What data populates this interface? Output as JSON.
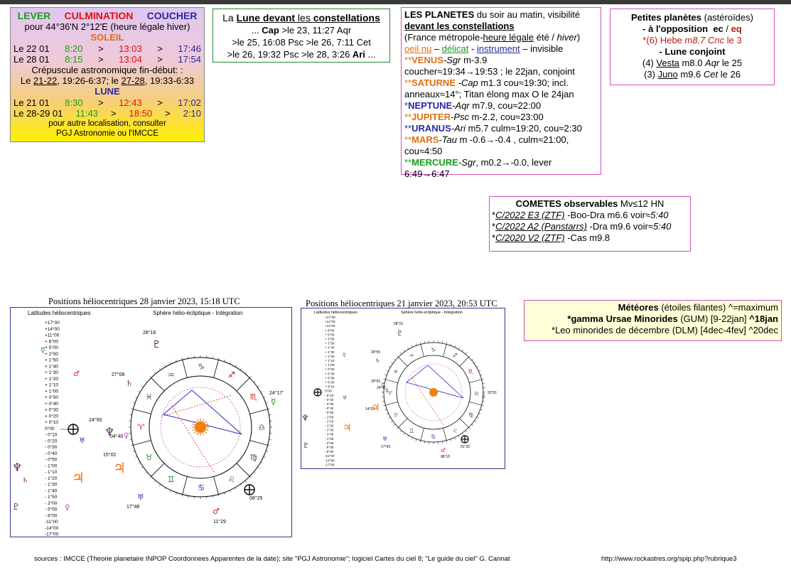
{
  "box1": {
    "hdr_lever": "LEVER",
    "hdr_culmination": "CULMINATION",
    "hdr_coucher": "COUCHER",
    "location": "pour 44°36'N  2°12'E (heure légale hiver)",
    "soleil_title": "SOLEIL",
    "soleil_rows": [
      {
        "date": "Le 22 01",
        "lever": "8:20",
        "culm": "13:03",
        "couch": "17:46"
      },
      {
        "date": "Le 28 01",
        "lever": "8:15",
        "culm": "13:04",
        "couch": "17:54"
      }
    ],
    "crepuscule_title": "Crépuscule astronomique fin-début: :",
    "crepuscule_pre": "Le ",
    "crepuscule_d1": "21-22",
    "crepuscule_mid": ", 19:26-6:37; le ",
    "crepuscule_d2": "27-28",
    "crepuscule_post": ", 19:33-6:33",
    "lune_title": "LUNE",
    "lune_rows": [
      {
        "date": "Le 21 01",
        "lever": "8:30",
        "culm": "12:43",
        "couch": "17:02"
      },
      {
        "date": "Le 28-29 01",
        "lever": "11:43",
        "culm": "18:50",
        "couch": "2:10"
      }
    ],
    "gt": ">",
    "footer1": "pour autre localisation, consulter",
    "footer2": "PGJ Astronomie ou l'IMCCE"
  },
  "box2": {
    "title_pre": "La ",
    "title_lune": "Lune devant",
    "title_mid": " les ",
    "title_const": "constellations",
    "l1_pre": "... ",
    "l1_b": "Cap",
    "l1_post": " >le 23, 11:27 Aqr",
    "l2": ">le 25, 16:08 Psc >le 26, 7:11 Cet",
    "l3_pre": ">le 26, 19:32 Psc >le 28, 3:26 ",
    "l3_b": "Ari",
    "l3_post": " ..."
  },
  "box3": {
    "title": "LES PLANETES",
    "title_post": " du soir au matin, visibilité",
    "subtitle": "devant les constellations",
    "france_pre": "(France métropole-",
    "france_u": "heure légale",
    "france_mid": " été / ",
    "france_i": "hiver",
    "france_post": ")",
    "leg_oeil": "oeil nu",
    "leg_sep1": " – ",
    "leg_delicat": "délicat",
    "leg_sep2": " - ",
    "leg_instrument": "instrument",
    "leg_sep3": " – invisible",
    "venus_star": "**",
    "venus": "VENUS",
    "venus_i": "-Sgr",
    "venus_m": " m-3.9",
    "venus_l2": "coucher≈19:34→19:53 ; le 22jan, conjoint",
    "saturne_star": "**",
    "saturne": "SATURNE",
    "saturne_i": " -Cap",
    "saturne_m": " m1.3 cou≈19:30; incl.",
    "saturne_l2": "anneaux≈14°; Titan élong max O le 24jan",
    "neptune_star": "*",
    "neptune": "NEPTUNE",
    "neptune_i": "-Aqr",
    "neptune_m": " m7.9, cou≈22:00",
    "jupiter_star": "**",
    "jupiter": "JUPITER",
    "jupiter_i": "-Psc",
    "jupiter_m": " m-2.2, cou≈23:00",
    "uranus_star": "**",
    "uranus": "URANUS",
    "uranus_i": "-Ari",
    "uranus_m": " m5.7 culm≈19:20, cou≈2:30",
    "mars_star": "**",
    "mars": "MARS",
    "mars_i": "-Tau",
    "mars_m": " m -0.6→-0.4 , culm≈21:00,",
    "mars_l2": "cou≈4:50",
    "mercure_star": "**",
    "mercure": "MERCURE",
    "mercure_i": "-Sgr",
    "mercure_m": ", m0.2→-0.0, lever",
    "mercure_l2": "6:49→6:47"
  },
  "box4": {
    "title": "Petites planètes",
    "title_post": " (astéroïdes)",
    "l2": "- à l'opposition",
    "l2_ec": "ec",
    "l2_sep": " / ",
    "l2_eq": "eq",
    "hebe_pre": "*(6) Hebe ",
    "hebe_i": "m8.7 Cnc",
    "hebe_post": " le 3",
    "lune_conj": "- Lune conjoint",
    "vesta_pre": "(4) ",
    "vesta": "Vesta",
    "vesta_m": " m8.0 ",
    "vesta_i": "Aqr",
    "vesta_post": " le 25",
    "juno_pre": "(3) ",
    "juno": "Juno",
    "juno_m": " m9.6 ",
    "juno_i": "Cet",
    "juno_post": " le 26"
  },
  "box5": {
    "title": "COMETES observables",
    "title_post": " Mv≤12 HN",
    "c1_star": "*",
    "c1": "C/2022 E3 (ZTF)",
    "c1_post": " -Boo-Dra m6.6 voir≈",
    "c1_i": "5:40",
    "c2_star": "*",
    "c2": "C/2022 A2 (Panstarrs)",
    "c2_post": " -Dra m9.6 voir≈",
    "c2_i": "5:40",
    "c3_star": "*",
    "c3": "C/2020 V2 (ZTF)",
    "c3_post": " -Cas m9.8"
  },
  "box6": {
    "title": "Météores",
    "title_post": " (étoiles filantes) ^=maximum",
    "m1": "*gamma Ursae Minorides",
    "m1_post": " (GUM) [9-22jan] ",
    "m1_b": "^18jan",
    "m2": "*Leo minorides de décembre (DLM) [4dec-4fev] ^20dec"
  },
  "chart1": {
    "title": "Positions héliocentriques 28 janvier 2023, 15:18 UTC",
    "left_label": "Latitudes héliocentriques",
    "right_label": "Sphère hélio-écliptique - Intégration",
    "ticks": [
      "+17°00",
      "+14°00",
      "+11°00",
      "+ 8°00",
      "+ 5°00",
      "+ 2°00",
      "+ 1°50",
      "+ 1°40",
      "+ 1°30",
      "+ 1°20",
      "+ 1°10",
      "+ 1°00",
      "+ 0°50",
      "+ 0°40",
      "+ 0°30",
      "+ 0°20",
      "+ 0°10",
      "0°00",
      "- 0°10",
      "- 0°20",
      "- 0°30",
      "- 0°40",
      "- 0°50",
      "- 1°00",
      "- 1°10",
      "- 1°20",
      "- 1°30",
      "- 1°40",
      "- 1°50",
      "- 2°00",
      "- 5°00",
      "- 8°00",
      "-11°00",
      "-14°00",
      "-17°00"
    ],
    "labels": {
      "a": "28°16",
      "b": "27°08",
      "c": "24°17'",
      "d": "24°50",
      "e": "04°40",
      "f": "15°02",
      "g": "17°48",
      "h": "08°25",
      "i": "11°29"
    }
  },
  "chart2": {
    "title": "Positions héliocentriques 21 janvier 2023, 20:53 UTC",
    "left_label": "Latitudes héliocentriques",
    "right_label": "Sphère hélio-écliptique - Intégration",
    "labels": {
      "a": "28°15",
      "b": "26°55",
      "c": "20°55",
      "d": "24°47",
      "e": "14°29",
      "f": "20°31",
      "g": "17°43",
      "h": "08°15",
      "i": "01°32"
    }
  },
  "footer": {
    "sources": "sources : IMCCE (Theorie planetaire INPOP Coordonnees Apparentes de la date); site \"PGJ Astronomie\"; logiciel  Cartes du ciel 8; \"Le guide du ciel\" G. Cannat",
    "url": "http://www.rockastres.org/spip.php?rubrique3"
  },
  "colors": {
    "green": "#1a9e1a",
    "red": "#e01010",
    "blue": "#2828a0",
    "orange": "#e07010",
    "magenta": "#d050c0"
  }
}
